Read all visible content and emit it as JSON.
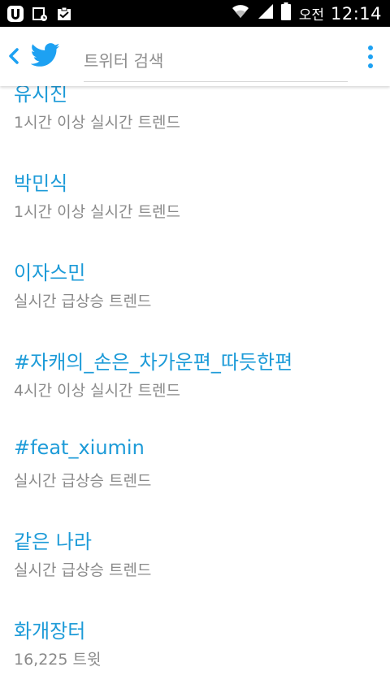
{
  "status_bar": {
    "ampm": "오전",
    "time": "12:14",
    "icons": [
      "u-app-icon",
      "calendar-icon",
      "clipboard-check-icon",
      "wifi-icon",
      "signal-icon",
      "battery-icon"
    ]
  },
  "app_bar": {
    "back_icon": "chevron-left-icon",
    "logo_icon": "twitter-bird-icon",
    "search_placeholder": "트위터 검색",
    "menu_icon": "overflow-menu-icon",
    "accent_color": "#1da1f2"
  },
  "trends": [
    {
      "title": "유시진",
      "subtitle": "1시간 이상 실시간 트렌드"
    },
    {
      "title": "박민식",
      "subtitle": "1시간 이상 실시간 트렌드"
    },
    {
      "title": "이자스민",
      "subtitle": "실시간 급상승 트렌드"
    },
    {
      "title": "#자캐의_손은_차가운편_따듯한편",
      "subtitle": "4시간 이상 실시간 트렌드"
    },
    {
      "title": "#feat_xiumin",
      "subtitle": "실시간 급상승 트렌드"
    },
    {
      "title": "같은 나라",
      "subtitle": "실시간 급상승 트렌드"
    },
    {
      "title": "화개장터",
      "subtitle": "16,225 트윗"
    }
  ]
}
